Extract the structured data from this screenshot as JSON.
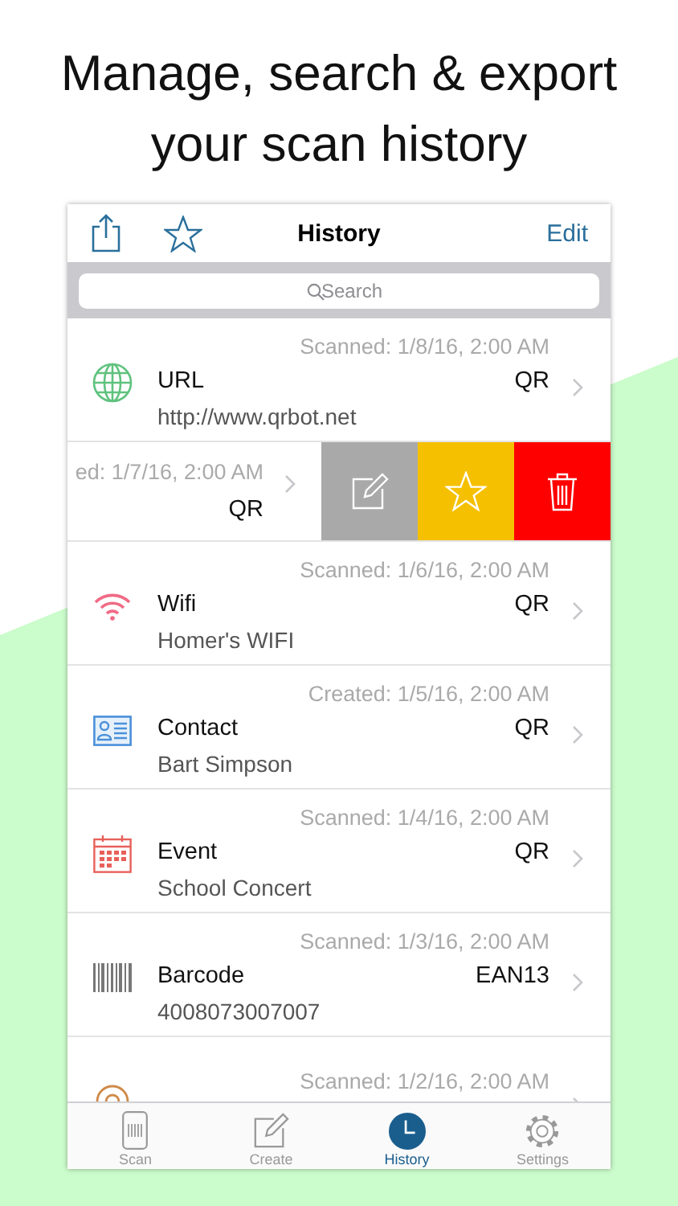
{
  "headline": [
    "Manage, search & export",
    "your scan history"
  ],
  "nav": {
    "title": "History",
    "edit": "Edit"
  },
  "search": {
    "placeholder": "Search"
  },
  "rows": [
    {
      "kind": "url",
      "date": "Scanned: 1/8/16, 2:00 AM",
      "title": "URL",
      "code": "QR",
      "subtitle": "http://www.qrbot.net"
    },
    {
      "kind": "swiped",
      "date": "ed: 1/7/16, 2:00 AM",
      "code": "QR"
    },
    {
      "kind": "wifi",
      "date": "Scanned: 1/6/16, 2:00 AM",
      "title": "Wifi",
      "code": "QR",
      "subtitle": "Homer's WIFI"
    },
    {
      "kind": "contact",
      "date": "Created: 1/5/16, 2:00 AM",
      "title": "Contact",
      "code": "QR",
      "subtitle": "Bart Simpson"
    },
    {
      "kind": "event",
      "date": "Scanned: 1/4/16, 2:00 AM",
      "title": "Event",
      "code": "QR",
      "subtitle": "School Concert"
    },
    {
      "kind": "barcode",
      "date": "Scanned: 1/3/16, 2:00 AM",
      "title": "Barcode",
      "code": "EAN13",
      "subtitle": "4008073007007"
    },
    {
      "kind": "location",
      "date": "Scanned: 1/2/16, 2:00 AM"
    }
  ],
  "tabs": [
    {
      "label": "Scan",
      "selected": false
    },
    {
      "label": "Create",
      "selected": false
    },
    {
      "label": "History",
      "selected": true
    },
    {
      "label": "Settings",
      "selected": false
    }
  ]
}
